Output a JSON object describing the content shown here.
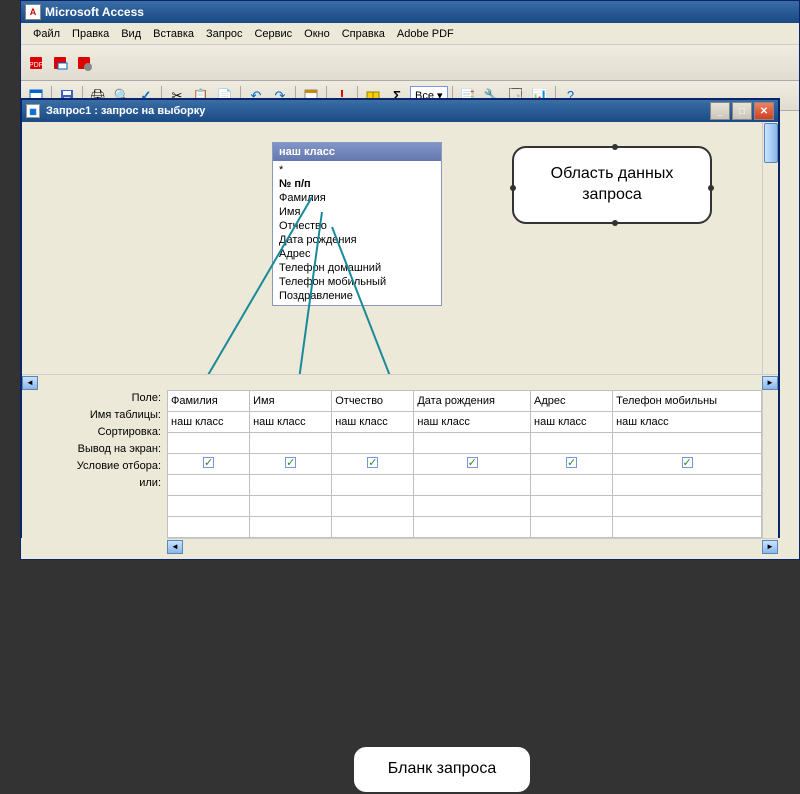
{
  "app": {
    "title": "Microsoft Access",
    "icon_letter": "A"
  },
  "menu": [
    "Файл",
    "Правка",
    "Вид",
    "Вставка",
    "Запрос",
    "Сервис",
    "Окно",
    "Справка",
    "Adobe PDF"
  ],
  "toolbar2_combo": "Все",
  "query_window": {
    "title": "Запрос1 : запрос на выборку",
    "table_box": {
      "title": "наш класс",
      "fields": [
        "*",
        "№ п/п",
        "Фамилия",
        "Имя",
        "Отчество",
        "Дата рождения",
        "Адрес",
        "Телефон домашний",
        "Телефон мобильный",
        "Поздравление"
      ]
    },
    "callout_data_area": "Область данных запроса",
    "callout_grid": "Бланк запроса",
    "row_labels": [
      "Поле:",
      "Имя таблицы:",
      "Сортировка:",
      "Вывод на экран:",
      "Условие отбора:",
      "или:"
    ],
    "columns": [
      {
        "field": "Фамилия",
        "table": "наш класс",
        "show": true
      },
      {
        "field": "Имя",
        "table": "наш класс",
        "show": true
      },
      {
        "field": "Отчество",
        "table": "наш класс",
        "show": true
      },
      {
        "field": "Дата рождения",
        "table": "наш класс",
        "show": true
      },
      {
        "field": "Адрес",
        "table": "наш класс",
        "show": true
      },
      {
        "field": "Телефон мобильны",
        "table": "наш класс",
        "show": true
      }
    ]
  }
}
